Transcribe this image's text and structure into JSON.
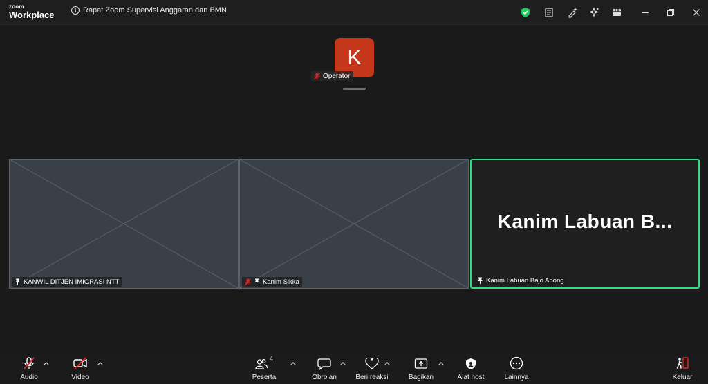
{
  "app": {
    "logo_top": "zoom",
    "logo_bottom": "Workplace"
  },
  "meeting": {
    "title": "Rapat Zoom Supervisi Anggaran dan BMN"
  },
  "titlebar_icons": [
    "shield-check-icon",
    "notes-icon",
    "edit-sparkle-icon",
    "ai-companion-icon",
    "apps-icon"
  ],
  "window_controls": [
    "minimize-icon",
    "restore-icon",
    "close-icon"
  ],
  "top_participant": {
    "avatar_letter": "K",
    "avatar_color": "#c4371b",
    "name": "Operator",
    "muted": true
  },
  "tiles": [
    {
      "name": "KANWIL DITJEN IMIGRASI NTT",
      "pinned": true,
      "muted": false,
      "video": true
    },
    {
      "name": "Kanim Sikka",
      "pinned": true,
      "muted": true,
      "video": true
    },
    {
      "name": "Kanim Labuan Bajo Apong",
      "display_name": "Kanim Labuan B...",
      "pinned": true,
      "muted": false,
      "video": false,
      "active_speaker": true
    }
  ],
  "accent_speaker_color": "#2fe07e",
  "toolbar": {
    "audio": "Audio",
    "video": "Video",
    "participants": "Peserta",
    "participant_count": "4",
    "chat": "Obrolan",
    "reactions": "Beri reaksi",
    "share": "Bagikan",
    "host_tools": "Alat host",
    "more": "Lainnya",
    "leave": "Keluar"
  }
}
